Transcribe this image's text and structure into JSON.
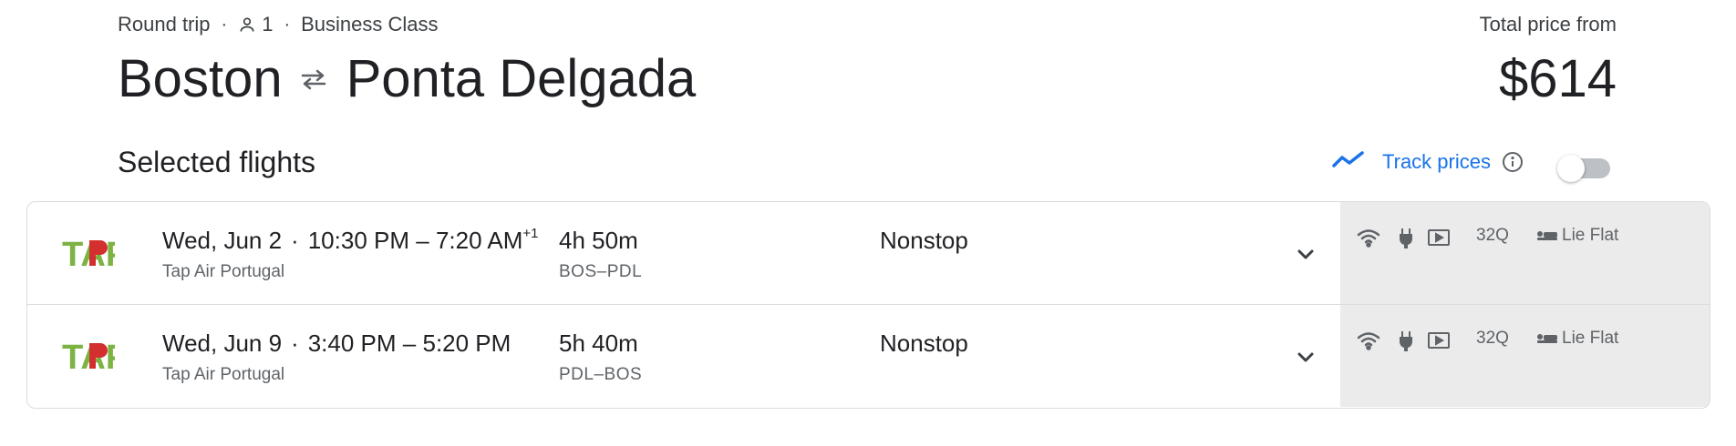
{
  "trip": {
    "type": "Round trip",
    "passengers": "1",
    "cabin": "Business Class",
    "origin": "Boston",
    "destination": "Ponta Delgada"
  },
  "price": {
    "label": "Total price from",
    "amount": "$614"
  },
  "section": {
    "title": "Selected flights"
  },
  "track_prices": {
    "label": "Track prices",
    "enabled": false
  },
  "flights": [
    {
      "date": "Wed, Jun 2",
      "depart": "10:30 PM",
      "arrive": "7:20 AM",
      "day_offset": "+1",
      "airline": "Tap Air Portugal",
      "duration": "4h 50m",
      "airports": "BOS–PDL",
      "stops": "Nonstop",
      "aircraft": "32Q",
      "seat": "Lie Flat"
    },
    {
      "date": "Wed, Jun 9",
      "depart": "3:40 PM",
      "arrive": "5:20 PM",
      "day_offset": "",
      "airline": "Tap Air Portugal",
      "duration": "5h 40m",
      "airports": "PDL–BOS",
      "stops": "Nonstop",
      "aircraft": "32Q",
      "seat": "Lie Flat"
    }
  ],
  "shared": {
    "dot": "·",
    "dash": "–"
  },
  "logo_text": "TAP",
  "colors": {
    "accent": "#1a73e8",
    "tap_green": "#7cb342",
    "tap_red": "#d32f2f",
    "amenity_bg": "#ebebeb"
  }
}
